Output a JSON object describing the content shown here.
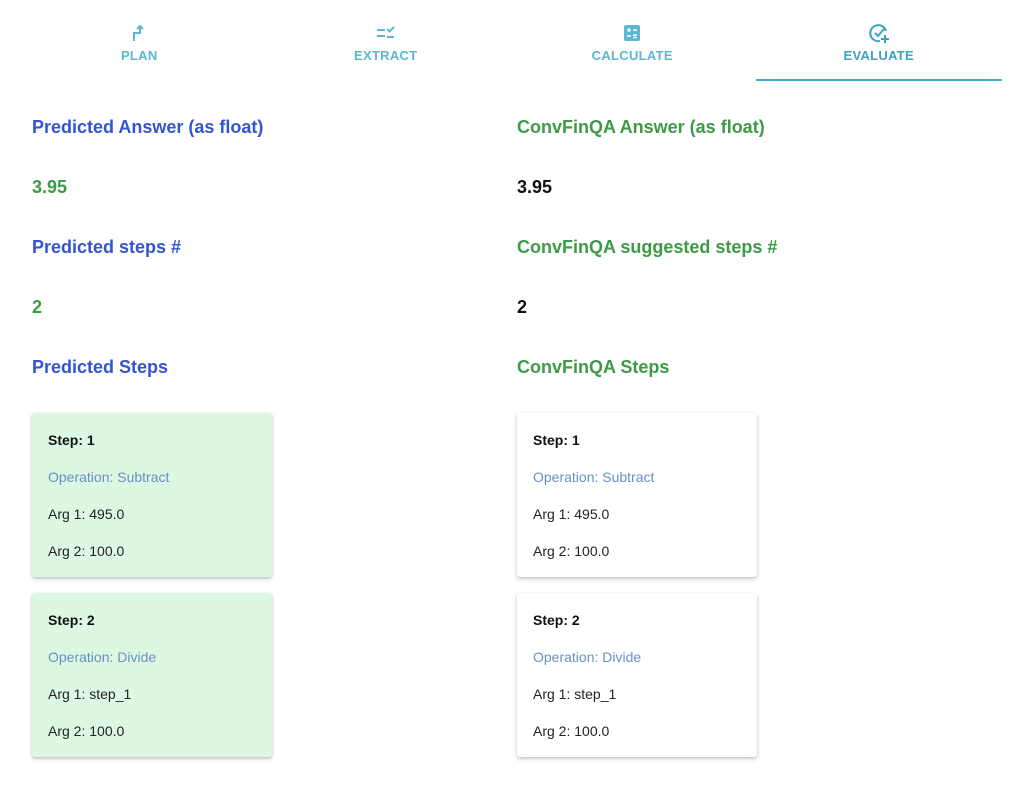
{
  "tabs": [
    {
      "label": "PLAN",
      "icon": "route-arrow-icon",
      "active": false
    },
    {
      "label": "EXTRACT",
      "icon": "list-check-icon",
      "active": false
    },
    {
      "label": "CALCULATE",
      "icon": "calculator-icon",
      "active": false
    },
    {
      "label": "EVALUATE",
      "icon": "check-circle-plus-icon",
      "active": true
    }
  ],
  "colors": {
    "accent": "#45aec7",
    "blue": "#3554d1",
    "green": "#3d9a45",
    "pred_card": "#dcf8e3",
    "op_text": "#6a8fc4"
  },
  "predicted": {
    "answer_heading": "Predicted Answer (as float)",
    "answer_value": "3.95",
    "steps_count_heading": "Predicted steps #",
    "steps_count_value": "2",
    "steps_heading": "Predicted Steps",
    "steps": [
      {
        "step": "Step: 1",
        "operation": "Operation: Subtract",
        "arg1": "Arg 1: 495.0",
        "arg2": "Arg 2: 100.0"
      },
      {
        "step": "Step: 2",
        "operation": "Operation: Divide",
        "arg1": "Arg 1: step_1",
        "arg2": "Arg 2: 100.0"
      }
    ]
  },
  "reference": {
    "answer_heading": "ConvFinQA Answer (as float)",
    "answer_value": "3.95",
    "steps_count_heading": "ConvFinQA suggested steps #",
    "steps_count_value": "2",
    "steps_heading": "ConvFinQA Steps",
    "steps": [
      {
        "step": "Step: 1",
        "operation": "Operation: Subtract",
        "arg1": "Arg 1: 495.0",
        "arg2": "Arg 2: 100.0"
      },
      {
        "step": "Step: 2",
        "operation": "Operation: Divide",
        "arg1": "Arg 1: step_1",
        "arg2": "Arg 2: 100.0"
      }
    ]
  }
}
